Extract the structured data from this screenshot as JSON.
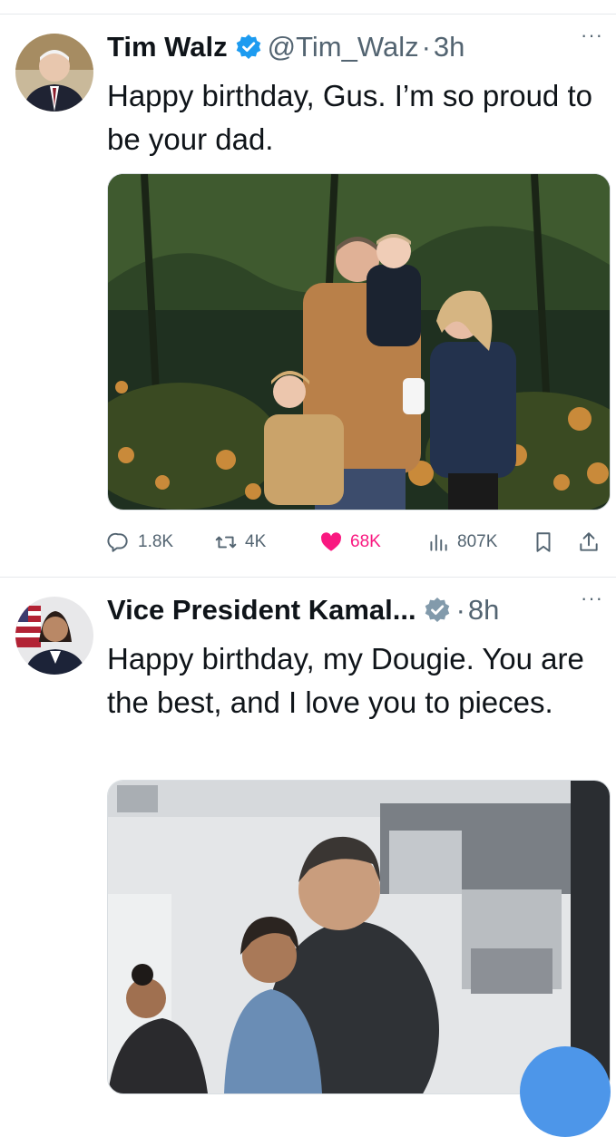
{
  "tweets": [
    {
      "author_name": "Tim Walz",
      "handle": "@Tim_Walz",
      "separator": "·",
      "time": "3h",
      "more_label": "···",
      "text": "Happy birthday, Gus. I’m so proud to be your dad.",
      "actions": {
        "replies": "1.8K",
        "retweets": "4K",
        "likes": "68K",
        "views": "807K"
      }
    },
    {
      "author_name": "Vice President Kamal...",
      "separator": "·",
      "time": "8h",
      "more_label": "···",
      "text": "Happy birthday, my Dougie. You are the best, and I love you to pieces."
    }
  ],
  "colors": {
    "like_active": "#f91880",
    "verified_blue": "#1d9bf0",
    "verified_gray": "#829aab",
    "secondary_text": "#536471"
  },
  "icons": [
    "verified-badge-icon",
    "more-icon",
    "reply-icon",
    "retweet-icon",
    "like-icon",
    "views-icon",
    "bookmark-icon",
    "share-icon"
  ]
}
